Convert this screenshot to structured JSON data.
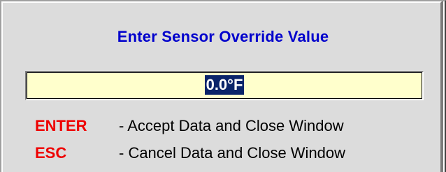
{
  "dialog": {
    "title": "Enter Sensor Override Value",
    "value": "0.0°F"
  },
  "hints": [
    {
      "key": "ENTER",
      "description": "- Accept Data and Close Window"
    },
    {
      "key": "ESC",
      "description": "- Cancel Data and Close Window"
    }
  ],
  "colors": {
    "title": "#0000cc",
    "key": "#ee0000",
    "field_bg": "#ffffcc",
    "selection_bg": "#0a246a",
    "dialog_bg": "#dcdcdc"
  }
}
